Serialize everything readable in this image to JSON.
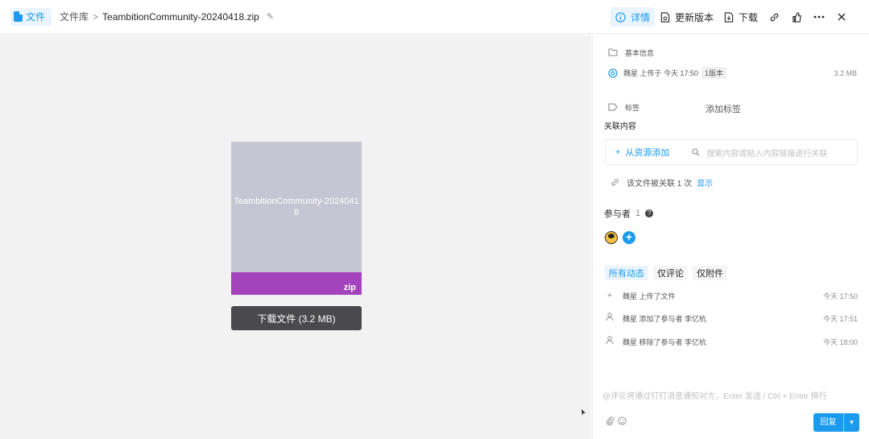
{
  "topbar": {
    "app_label": "文件",
    "breadcrumb_root": "文件库",
    "breadcrumb_sep": ">",
    "file_name": "TeambitionCommunity-20240418.zip",
    "actions": {
      "detail": "详情",
      "update_version": "更新版本",
      "download": "下载"
    }
  },
  "preview": {
    "thumb_name": "TeambitionCommunity-20240418",
    "ext": "zip",
    "download_button": "下载文件 (3.2 MB)"
  },
  "panel": {
    "basic_info": "基本信息",
    "uploader": "魏星 上传于 今天 17:50",
    "version_tag": "1版本",
    "size": "3.2 MB",
    "tags_label": "标签",
    "add_tag": "添加标签",
    "related_label": "关联内容",
    "related_add": "从资源添加",
    "related_search": "搜索内容或粘入内容链接进行关联",
    "linked_text": "该文件被关联 1 次",
    "linked_show": "显示",
    "participants_label": "参与者",
    "participants_count": "1",
    "tabs": [
      "所有动态",
      "仅评论",
      "仅附件"
    ],
    "activities": [
      {
        "text": "魏星 上传了文件",
        "time": "今天 17:50",
        "icon": "plus-icon"
      },
      {
        "text": "魏星 添加了参与者 李亿杭",
        "time": "今天 17:51",
        "icon": "user-icon"
      },
      {
        "text": "魏星 移除了参与者 李亿杭",
        "time": "今天 18:00",
        "icon": "user-icon"
      }
    ],
    "comment_placeholder": "@评论将通过钉钉消息通知对方，Enter 发送 / Ctrl + Enter 换行",
    "reply_button": "回复"
  },
  "colors": {
    "accent": "#1b9aee",
    "zip_band": "#a444bd",
    "thumb_bg": "#c6c5d2",
    "download_btn": "#4a4a4e"
  }
}
